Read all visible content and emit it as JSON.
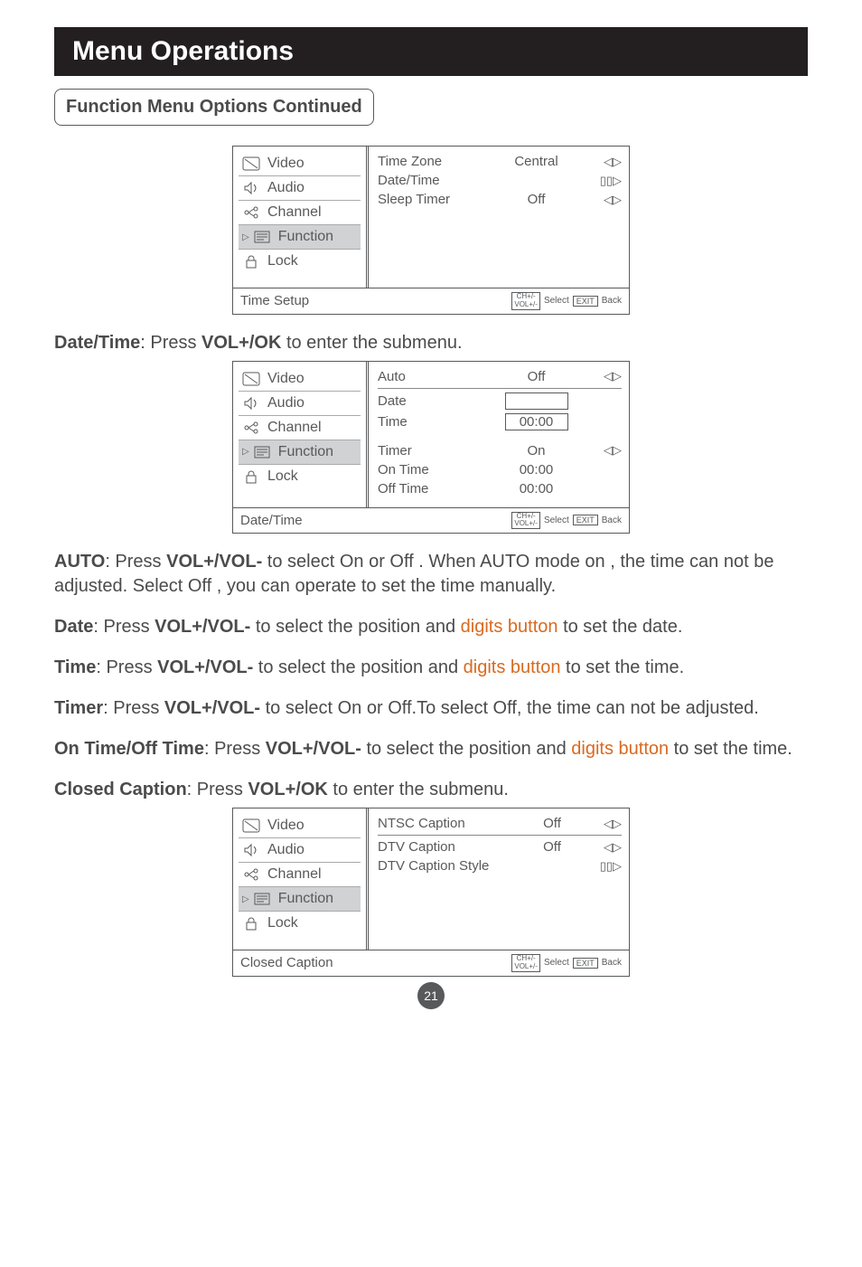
{
  "banner": "Menu Operations",
  "subtitle": "Function Menu Options Continued",
  "sidebar": {
    "items": [
      {
        "label": "Video"
      },
      {
        "label": "Audio"
      },
      {
        "label": "Channel"
      },
      {
        "label": "Function"
      },
      {
        "label": "Lock"
      }
    ]
  },
  "legend": {
    "ch": "CH+/-",
    "vol": "VOL+/-",
    "select": "Select",
    "exit": "EXIT",
    "back": "Back"
  },
  "menu1": {
    "rows": {
      "timezone_label": "Time Zone",
      "timezone_value": "Central",
      "dt_label": "Date/Time",
      "sleep_label": "Sleep Timer",
      "sleep_value": "Off"
    },
    "footer_title": "Time Setup"
  },
  "para1": {
    "pre": "Date/Time",
    "mid": ": Press ",
    "bold2": "VOL+/OK",
    "post": " to enter the submenu."
  },
  "menu2": {
    "rows": {
      "auto_label": "Auto",
      "auto_value": "Off",
      "date_label": "Date",
      "time_label": "Time",
      "time_value": "00:00",
      "timer_label": "Timer",
      "timer_value": "On",
      "ontime_label": "On Time",
      "ontime_value": "00:00",
      "offtime_label": "Off Time",
      "offtime_value": "00:00"
    },
    "footer_title": "Date/Time"
  },
  "para_auto": {
    "b1": "AUTO",
    "t1": ": Press ",
    "b2": "VOL+/VOL-",
    "t2": " to select On or Off . When AUTO mode on , the time can not be adjusted. Select Off , you can operate to set the time manually."
  },
  "para_date": {
    "b1": "Date",
    "t1": ": Press ",
    "b2": "VOL+/VOL-",
    "t2": " to select the position and ",
    "hl": "digits button",
    "t3": " to set the date."
  },
  "para_time": {
    "b1": "Time",
    "t1": ": Press ",
    "b2": "VOL+/VOL-",
    "t2": " to select the position and ",
    "hl": "digits button",
    "t3": " to set the time."
  },
  "para_timer": {
    "b1": "Timer",
    "t1": ": Press ",
    "b2": "VOL+/VOL-",
    "t2": " to select On or Off.To select Off, the time can not be adjusted."
  },
  "para_onoff": {
    "b1": "On Time/Off Time",
    "t1": ": Press ",
    "b2": "VOL+/VOL-",
    "t2": " to select the position and ",
    "hl": "digits button",
    "t3": " to set the time."
  },
  "para_cc": {
    "b1": "Closed Caption",
    "t1": ": Press ",
    "b2": "VOL+/OK",
    "t2": " to enter the submenu."
  },
  "menu3": {
    "rows": {
      "ntsc_label": "NTSC Caption",
      "ntsc_value": "Off",
      "dtv_label": "DTV Caption",
      "dtv_value": "Off",
      "style_label": "DTV Caption Style"
    },
    "footer_title": "Closed Caption"
  },
  "arrows": {
    "lr": "◁▷",
    "enter": "▯▯▷"
  },
  "page_number": "21"
}
